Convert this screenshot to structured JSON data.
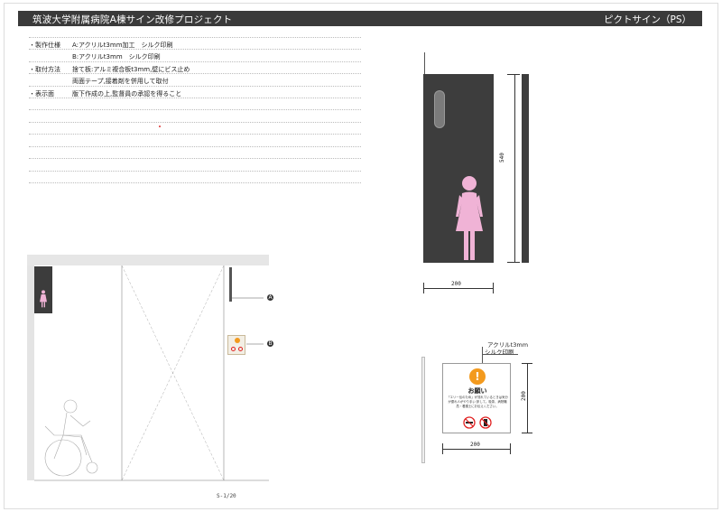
{
  "header": {
    "title": "筑波大学附属病院A棟サイン改修プロジェクト",
    "category": "ピクトサイン（PS）"
  },
  "specs": [
    {
      "label": "・製作仕様",
      "value": "A:アクリルt3mm加工　シルク印刷"
    },
    {
      "label": "",
      "value": "B:アクリルt3mm　シルク印刷"
    },
    {
      "label": "・取付方法",
      "value": "捨て板:アルミ複合板t3mm,壁にビス止め"
    },
    {
      "label": "",
      "value": "両面テープ,接着剤を併用して取付"
    },
    {
      "label": "・表示面",
      "value": "版下作成の上,監督員の承認を得ること"
    }
  ],
  "plan": {
    "callout_a": "A",
    "callout_b": "B",
    "page_number": "S-1/20"
  },
  "sign_a": {
    "height_dim": "540",
    "width_dim": "200"
  },
  "sign_b": {
    "material_note_1": "アクリルt3mm",
    "material_note_2": "シルク印刷",
    "exclamation": "!",
    "title": "お願い",
    "body": "「エリー伝のため」が流れているときは気分が優れ人がやり手い 訳して。吸茶、病院職員・看護士にお伝えください。",
    "height_dim": "200",
    "width_dim": "200"
  },
  "colors": {
    "header_bg": "#3a3a3a",
    "sign_dark": "#3d3d3d",
    "pictogram_pink": "#f0b3d6",
    "notice_orange": "#f39a1e",
    "prohibit_red": "#e02020"
  },
  "icons": [
    "female-pictogram-icon",
    "exclamation-icon",
    "no-smoking-icon",
    "no-mobile-icon",
    "wheelchair-user-icon"
  ]
}
